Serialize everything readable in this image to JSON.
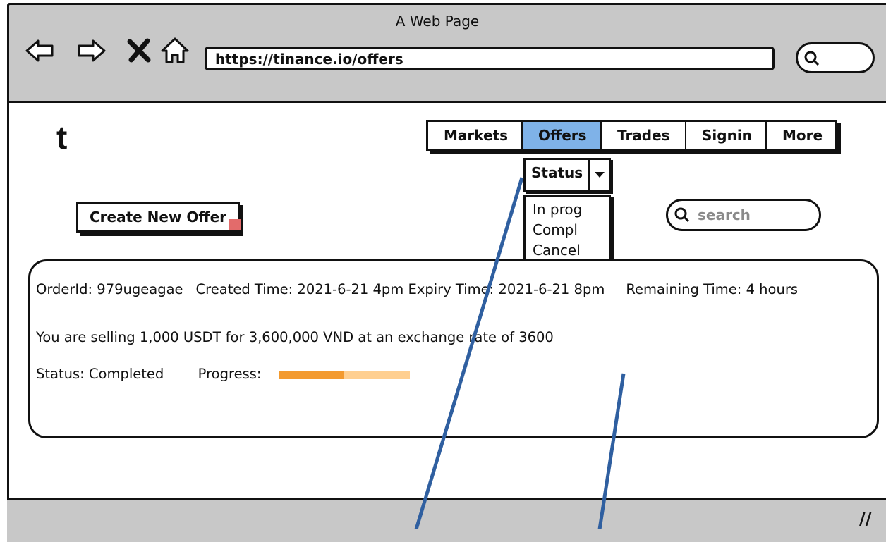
{
  "window": {
    "title": "A Web Page",
    "url": "https://tinance.io/offers"
  },
  "logo": {
    "text": "t"
  },
  "nav": {
    "tabs": [
      {
        "label": "Markets",
        "active": false
      },
      {
        "label": "Offers",
        "active": true
      },
      {
        "label": "Trades",
        "active": false
      },
      {
        "label": "Signin",
        "active": false
      },
      {
        "label": "More",
        "active": false
      }
    ]
  },
  "status_filter": {
    "selected": "Status",
    "options": [
      "In prog",
      "Compl",
      "Cancel"
    ]
  },
  "actions": {
    "create_label": "Create New Offer"
  },
  "search": {
    "placeholder": "search"
  },
  "offer": {
    "order_id": "OrderId: 979ugeagae",
    "created": "Created Time: 2021-6-21 4pm",
    "expiry": "Expiry Time: 2021-6-21 8pm",
    "remaining": "Remaining Time: 4 hours",
    "summary": "You are selling 1,000 USDT for 3,600,000 VND at an exchange rate of 3600",
    "status": "Status: Completed",
    "progress_label": "Progress:",
    "progress_fraction": 0.5
  },
  "colors": {
    "chrome": "#c8c8c8",
    "active_tab": "#7fb2e8",
    "progress_fill": "#f39a2f",
    "progress_track": "#ffcf90",
    "annotation_line": "#2f5fa0"
  }
}
